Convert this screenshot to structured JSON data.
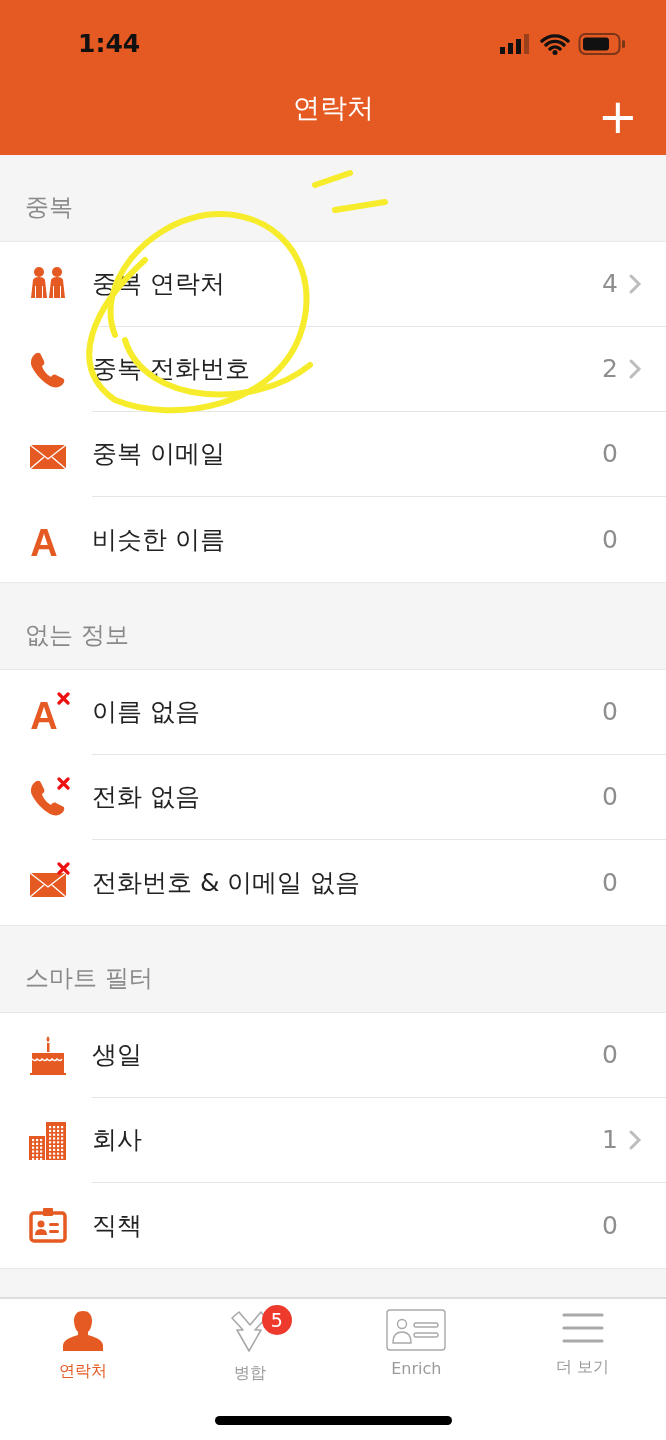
{
  "status_bar": {
    "time": "1:44"
  },
  "nav": {
    "title": "연락처",
    "add_symbol": "+"
  },
  "sections": [
    {
      "header": "중복",
      "rows": [
        {
          "kind": "people",
          "crossed": false,
          "label": "중복 연락처",
          "count": "4",
          "chevron": true
        },
        {
          "kind": "phone",
          "crossed": false,
          "label": "중복 전화번호",
          "count": "2",
          "chevron": true
        },
        {
          "kind": "mail",
          "crossed": false,
          "label": "중복 이메일",
          "count": "0",
          "chevron": false
        },
        {
          "kind": "letter",
          "glyph": "A",
          "crossed": false,
          "label": "비슷한 이름",
          "count": "0",
          "chevron": false
        }
      ]
    },
    {
      "header": "없는 정보",
      "rows": [
        {
          "kind": "letter",
          "glyph": "A",
          "crossed": true,
          "label": "이름 없음",
          "count": "0",
          "chevron": false
        },
        {
          "kind": "phone",
          "crossed": true,
          "label": "전화 없음",
          "count": "0",
          "chevron": false
        },
        {
          "kind": "mail",
          "crossed": true,
          "label": "전화번호 & 이메일 없음",
          "count": "0",
          "chevron": false
        }
      ]
    },
    {
      "header": "스마트 필터",
      "rows": [
        {
          "kind": "cake",
          "crossed": false,
          "label": "생일",
          "count": "0",
          "chevron": false
        },
        {
          "kind": "building",
          "crossed": false,
          "label": "회사",
          "count": "1",
          "chevron": true
        },
        {
          "kind": "idcard",
          "crossed": false,
          "label": "직책",
          "count": "0",
          "chevron": false
        }
      ]
    }
  ],
  "tabs": [
    {
      "kind": "person",
      "label": "연락처",
      "selected": true
    },
    {
      "kind": "merge",
      "label": "병합",
      "selected": false,
      "badge": "5"
    },
    {
      "kind": "card",
      "label": "Enrich",
      "selected": false
    },
    {
      "kind": "menu",
      "label": "더 보기",
      "selected": false
    }
  ]
}
